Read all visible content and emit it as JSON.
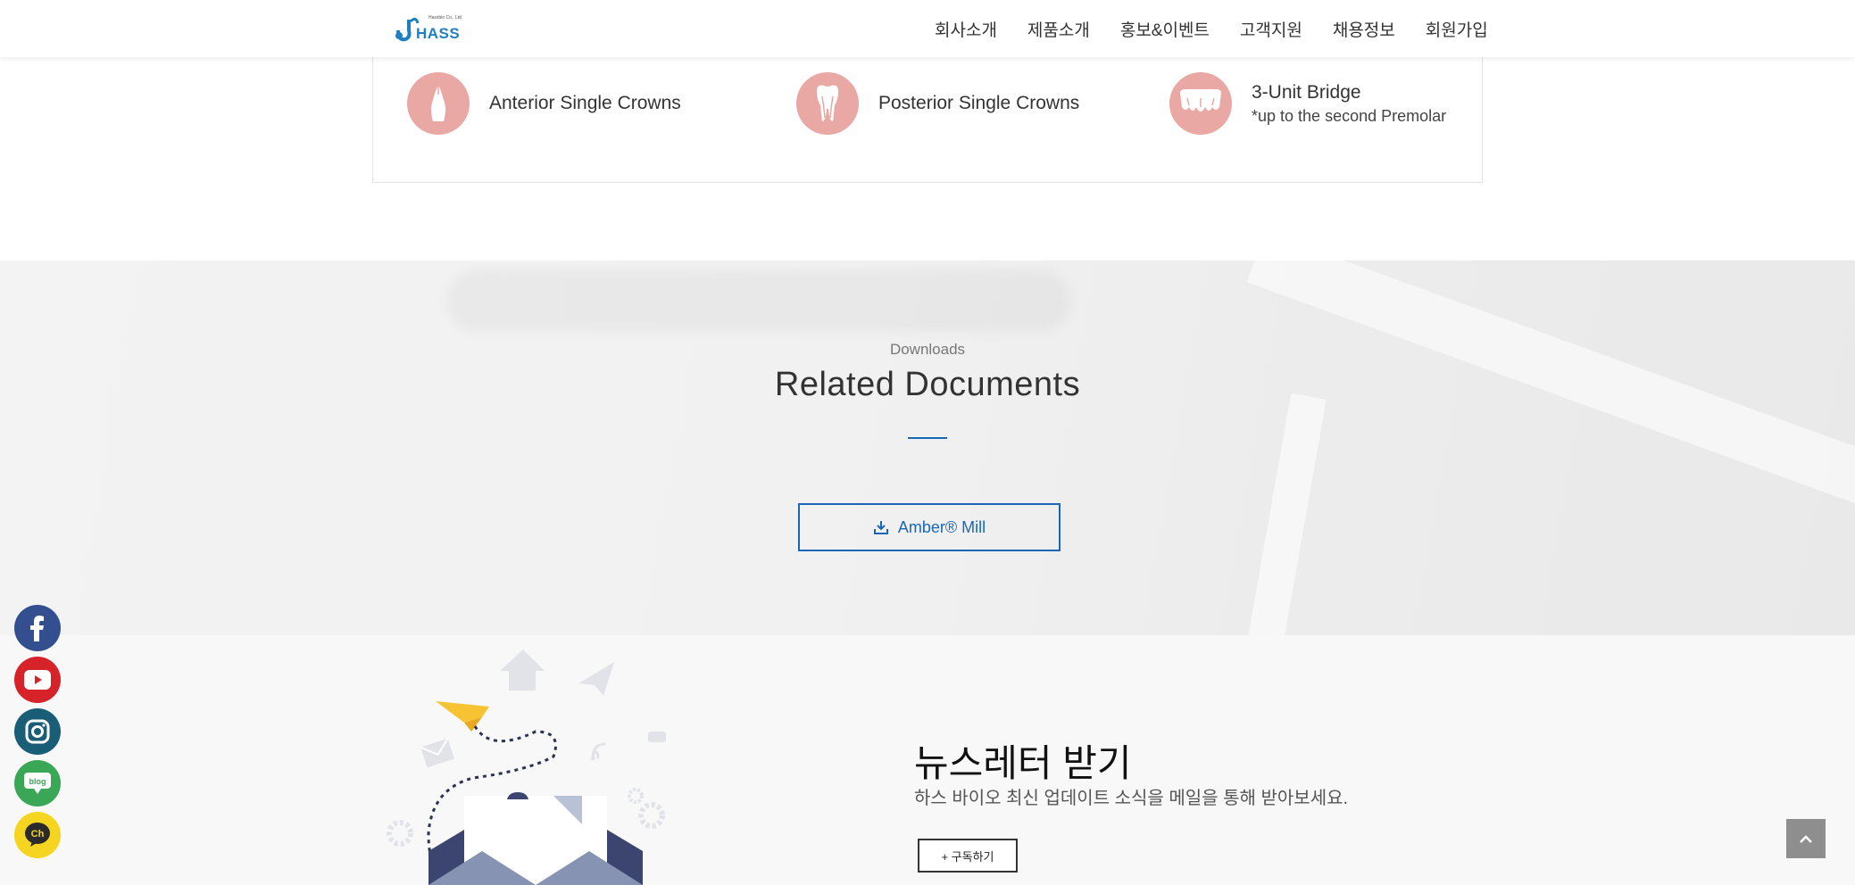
{
  "header": {
    "logo_text": "HASS",
    "logo_sub": "Hassbio Co., Ltd",
    "nav": [
      "회사소개",
      "제품소개",
      "홍보&이벤트",
      "고객지원",
      "채용정보",
      "회원가입"
    ]
  },
  "products": [
    {
      "label": "Anterior Single Crowns",
      "sub": "",
      "icon": "anterior-crown-icon"
    },
    {
      "label": "Posterior Single Crowns",
      "sub": "",
      "icon": "molar-tooth-icon"
    },
    {
      "label": "3-Unit Bridge",
      "sub": "*up to the  second Premolar",
      "icon": "bridge-icon"
    }
  ],
  "downloads": {
    "eyebrow": "Downloads",
    "title": "Related Documents",
    "button_label": "Amber® Mill"
  },
  "newsletter": {
    "title": "뉴스레터 받기",
    "subtitle": "하스 바이오 최신 업데이트 소식을 메일을 통해 받아보세요.",
    "button_label": "+ 구독하기"
  },
  "social": [
    {
      "name": "facebook",
      "color": "#344f8f"
    },
    {
      "name": "youtube",
      "color": "#d6232a"
    },
    {
      "name": "instagram",
      "color": "#1a5d77"
    },
    {
      "name": "blog",
      "color": "#3aa757",
      "label": "blog"
    },
    {
      "name": "kakao-channel",
      "color": "#f6d521",
      "label": "Ch"
    }
  ],
  "colors": {
    "accent": "#1a67b8",
    "product_icon_bg": "#e9a8a4"
  }
}
